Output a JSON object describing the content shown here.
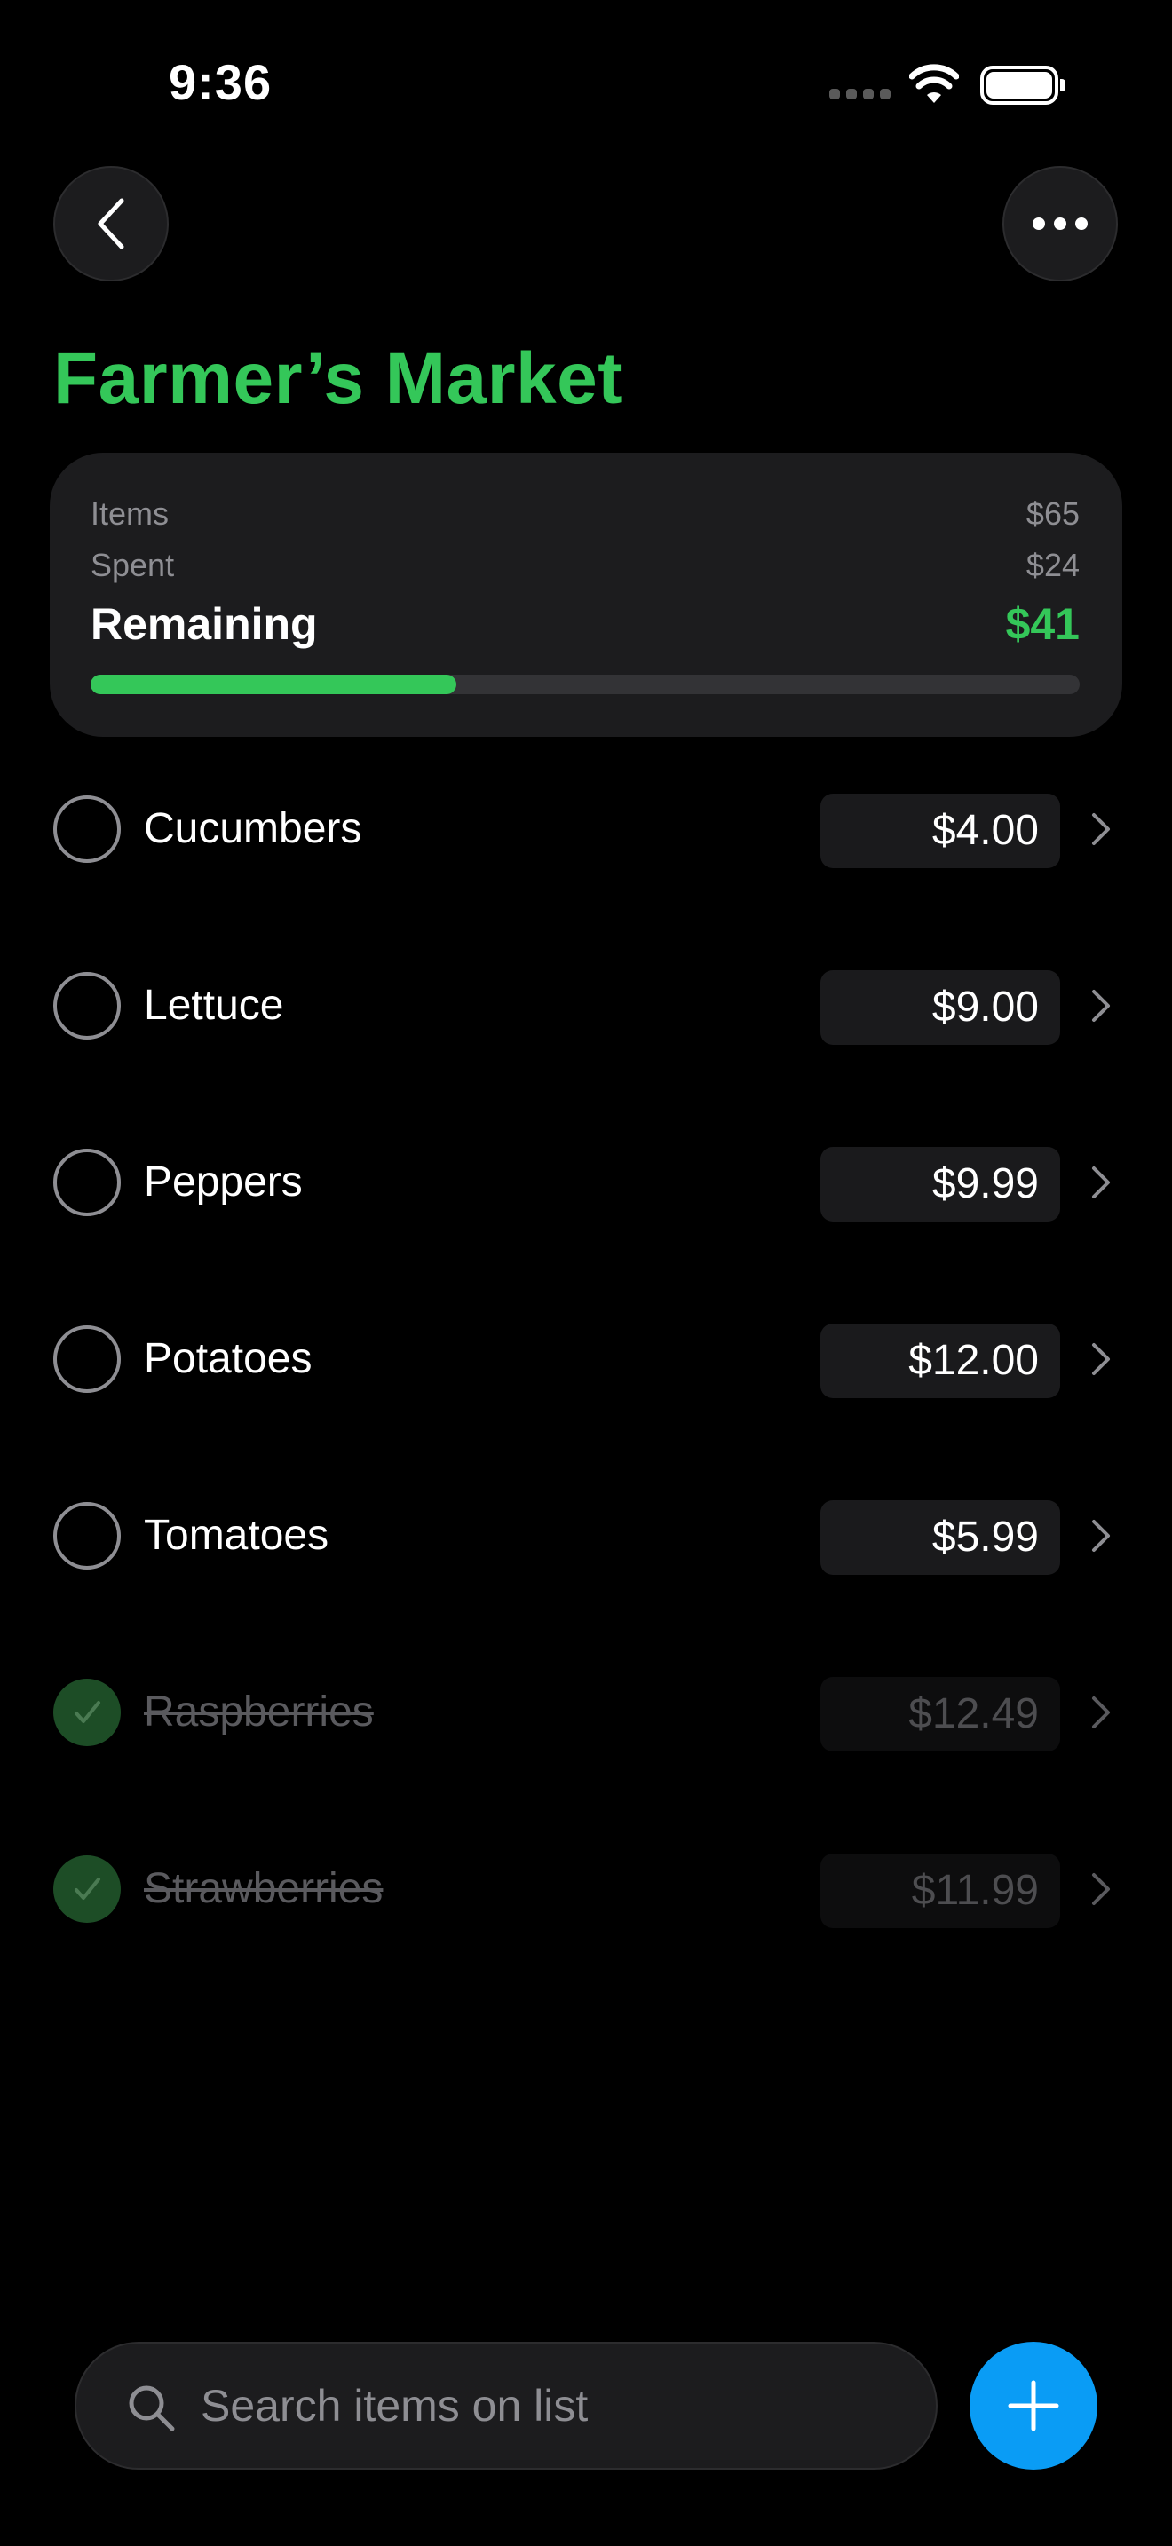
{
  "status_bar": {
    "time": "9:36"
  },
  "header": {
    "title": "Farmer’s Market"
  },
  "summary": {
    "items_label": "Items",
    "items_value": "$65",
    "spent_label": "Spent",
    "spent_value": "$24",
    "remaining_label": "Remaining",
    "remaining_value": "$41",
    "progress_fraction": 0.37
  },
  "items": [
    {
      "name": "Cucumbers",
      "price": "$4.00",
      "checked": false
    },
    {
      "name": "Lettuce",
      "price": "$9.00",
      "checked": false
    },
    {
      "name": "Peppers",
      "price": "$9.99",
      "checked": false
    },
    {
      "name": "Potatoes",
      "price": "$12.00",
      "checked": false
    },
    {
      "name": "Tomatoes",
      "price": "$5.99",
      "checked": false
    },
    {
      "name": "Raspberries",
      "price": "$12.49",
      "checked": true
    },
    {
      "name": "Strawberries",
      "price": "$11.99",
      "checked": true
    }
  ],
  "search": {
    "placeholder": "Search items on list"
  },
  "colors": {
    "accent": "#34c759",
    "add_button": "#0a9cf5",
    "background": "#000000",
    "card": "#1c1c1e"
  },
  "icons": {
    "back": "chevron-left-icon",
    "more": "ellipsis-icon",
    "search": "magnifier-icon",
    "add": "plus-icon",
    "row": "chevron-right-icon",
    "check": "checkmark-icon"
  }
}
